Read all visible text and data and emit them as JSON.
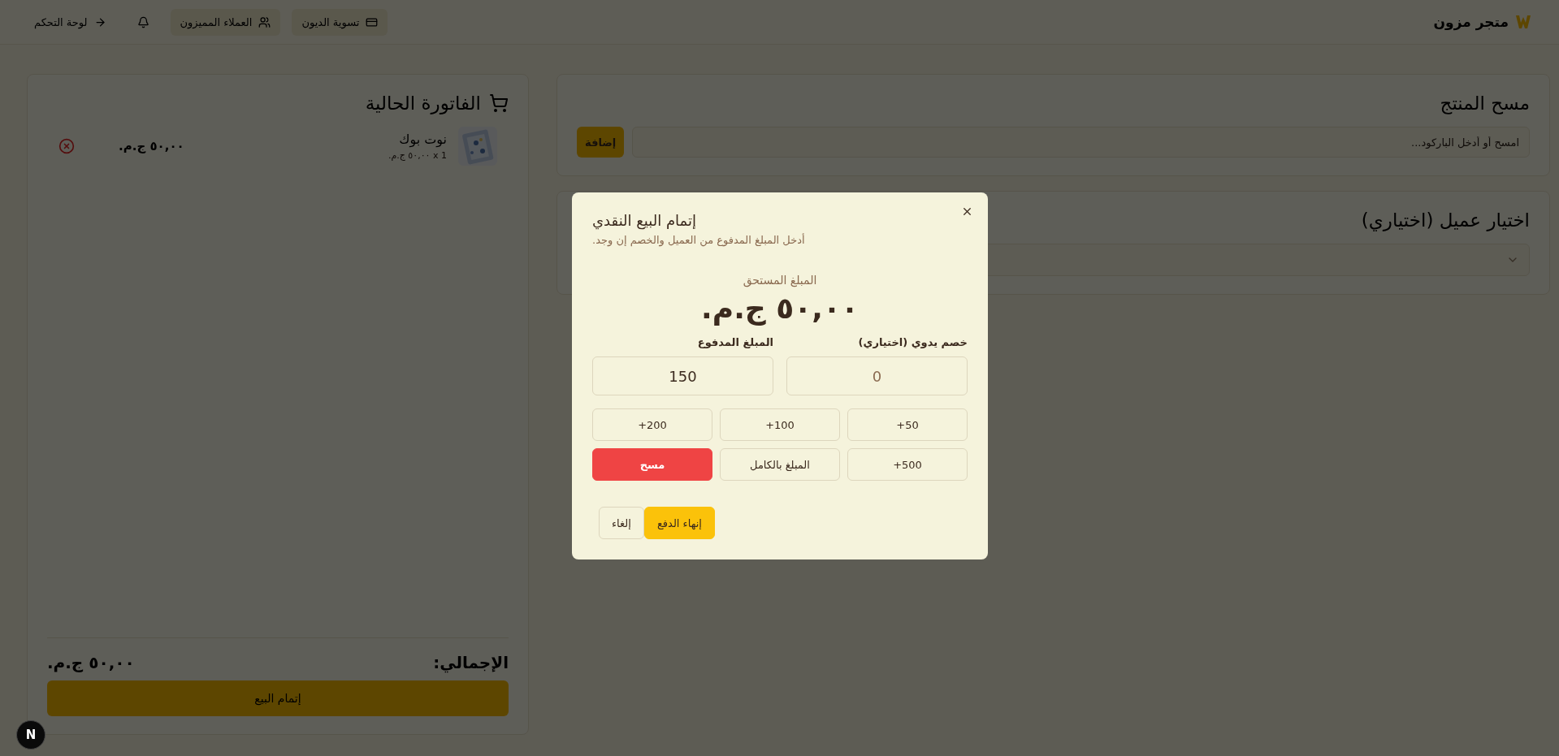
{
  "header": {
    "brand": "متجر مزون",
    "nav": [
      {
        "kind": "button",
        "label": "تسوية الديون"
      },
      {
        "kind": "button",
        "label": "العملاء المميزون"
      },
      {
        "kind": "icon"
      },
      {
        "kind": "link",
        "label": "لوحة التحكم"
      }
    ]
  },
  "scan_card": {
    "title": "مسح المنتج",
    "placeholder": "امسح أو أدخل الباركود...",
    "button": "إضافة"
  },
  "customer_card": {
    "title": "اختيار عميل (اختياري)"
  },
  "invoice": {
    "title": "الفاتورة الحالية",
    "items": [
      {
        "name": "نوت بوك",
        "detail": "1 x ٥٠,٠٠ ج.م.",
        "total": "٥٠,٠٠ ج.م."
      }
    ],
    "total_label": "الإجمالي:",
    "total_value": "٥٠,٠٠ ج.م.",
    "checkout": "إتمام البيع"
  },
  "dialog": {
    "title": "إتمام البيع النقدي",
    "subtitle": "أدخل المبلغ المدفوع من العميل والخصم إن وجد.",
    "due_label": "المبلغ المستحق",
    "due_value": "٥٠,٠٠ ج.م.",
    "fields": [
      {
        "label": "خصم يدوي (اختياري)",
        "placeholder": "0"
      },
      {
        "label": "المبلغ المدفوع",
        "value": "150"
      }
    ],
    "quick": [
      {
        "label": "+50",
        "kind": "add"
      },
      {
        "label": "+100",
        "kind": "add"
      },
      {
        "label": "+200",
        "kind": "add"
      },
      {
        "label": "+500",
        "kind": "add"
      },
      {
        "label": "المبلغ بالكامل",
        "kind": "add"
      },
      {
        "label": "مسح",
        "kind": "clear"
      }
    ],
    "actions": [
      {
        "label": "إنهاء الدفع",
        "kind": "primary"
      },
      {
        "label": "إلغاء",
        "kind": "outline"
      }
    ]
  },
  "dev_badge": "N"
}
